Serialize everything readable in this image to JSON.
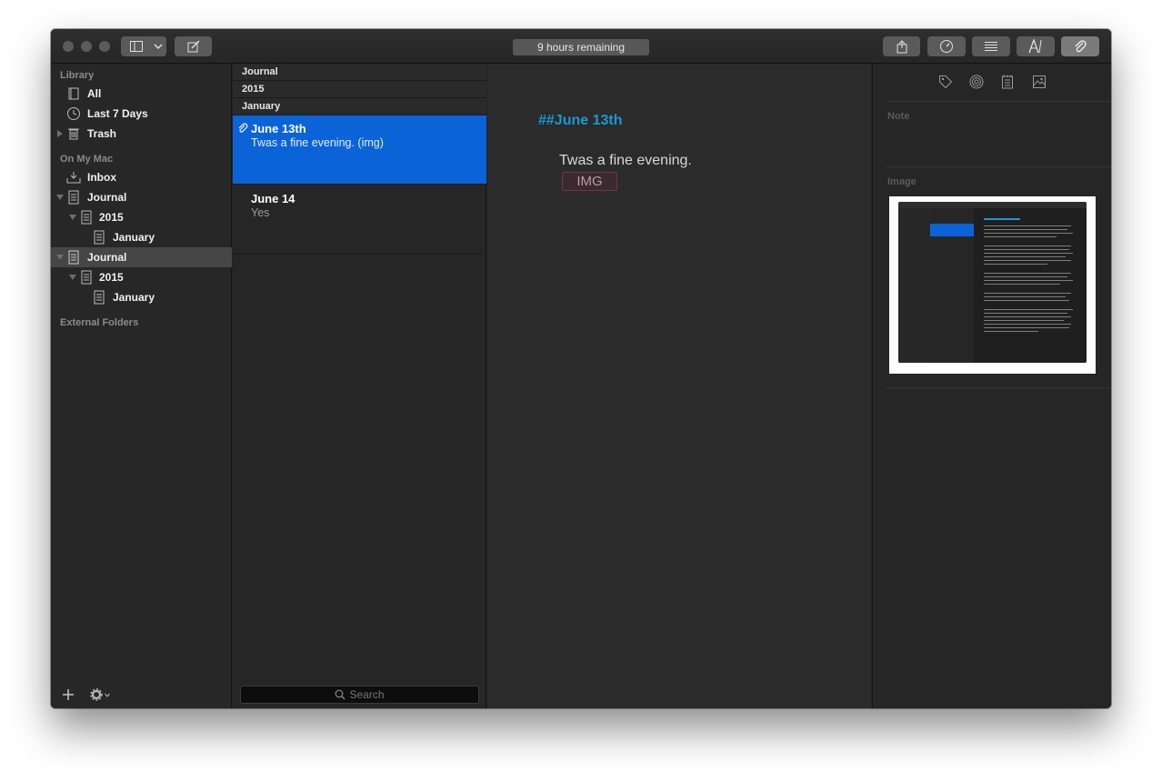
{
  "toolbar": {
    "status_text": "9 hours remaining"
  },
  "sidebar": {
    "sections": {
      "library": "Library",
      "on_my_mac": "On My Mac",
      "external": "External Folders"
    },
    "library_items": [
      {
        "label": "All",
        "icon": "book-icon"
      },
      {
        "label": "Last 7 Days",
        "icon": "clock-icon"
      },
      {
        "label": "Trash",
        "icon": "trash-icon"
      }
    ],
    "mac_items": [
      {
        "label": "Inbox",
        "icon": "inbox-icon"
      },
      {
        "label": "Journal",
        "icon": "journal-icon"
      },
      {
        "label": "2015",
        "icon": "journal-icon"
      },
      {
        "label": "January",
        "icon": "journal-icon"
      },
      {
        "label": "Journal",
        "icon": "journal-icon"
      },
      {
        "label": "2015",
        "icon": "journal-icon"
      },
      {
        "label": "January",
        "icon": "journal-icon"
      }
    ]
  },
  "list": {
    "breadcrumb": [
      "Journal",
      "2015",
      "January"
    ],
    "entries": [
      {
        "title": "June 13th",
        "subtitle": "Twas a fine evening. (img)",
        "selected": true,
        "has_attachment": true
      },
      {
        "title": "June 14",
        "subtitle": "Yes",
        "selected": false,
        "has_attachment": false
      }
    ],
    "search_placeholder": "Search"
  },
  "editor": {
    "heading": "##June 13th",
    "body": "Twas a fine evening.",
    "image_placeholder": "IMG"
  },
  "inspector": {
    "icons": [
      "tag-icon",
      "target-icon",
      "notepad-icon",
      "image-icon"
    ],
    "note_label": "Note",
    "image_label": "Image"
  },
  "colors": {
    "accent_blue": "#0b63d8",
    "heading_blue": "#1a98d5",
    "window_bg": "#232323"
  }
}
